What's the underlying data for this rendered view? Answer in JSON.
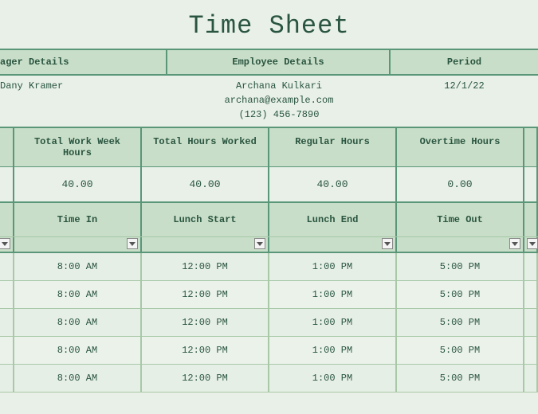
{
  "title": "Time Sheet",
  "headers": {
    "manager": "ager Details",
    "employee": "Employee Details",
    "period": "Period"
  },
  "details": {
    "manager_name": "Dany Kramer",
    "employee_name": "Archana Kulkari",
    "employee_email": "archana@example.com",
    "employee_phone": "(123) 456-7890",
    "period": "12/1/22"
  },
  "summary": {
    "labels": {
      "total_week": "Total Work Week Hours",
      "total_worked": "Total Hours Worked",
      "regular": "Regular Hours",
      "overtime": "Overtime Hours"
    },
    "values": {
      "total_week": "40.00",
      "total_worked": "40.00",
      "regular": "40.00",
      "overtime": "0.00"
    }
  },
  "columns": {
    "time_in": "Time In",
    "lunch_start": "Lunch Start",
    "lunch_end": "Lunch End",
    "time_out": "Time Out"
  },
  "rows": [
    {
      "time_in": "8:00 AM",
      "lunch_start": "12:00 PM",
      "lunch_end": "1:00 PM",
      "time_out": "5:00 PM"
    },
    {
      "time_in": "8:00 AM",
      "lunch_start": "12:00 PM",
      "lunch_end": "1:00 PM",
      "time_out": "5:00 PM"
    },
    {
      "time_in": "8:00 AM",
      "lunch_start": "12:00 PM",
      "lunch_end": "1:00 PM",
      "time_out": "5:00 PM"
    },
    {
      "time_in": "8:00 AM",
      "lunch_start": "12:00 PM",
      "lunch_end": "1:00 PM",
      "time_out": "5:00 PM"
    },
    {
      "time_in": "8:00 AM",
      "lunch_start": "12:00 PM",
      "lunch_end": "1:00 PM",
      "time_out": "5:00 PM"
    }
  ]
}
